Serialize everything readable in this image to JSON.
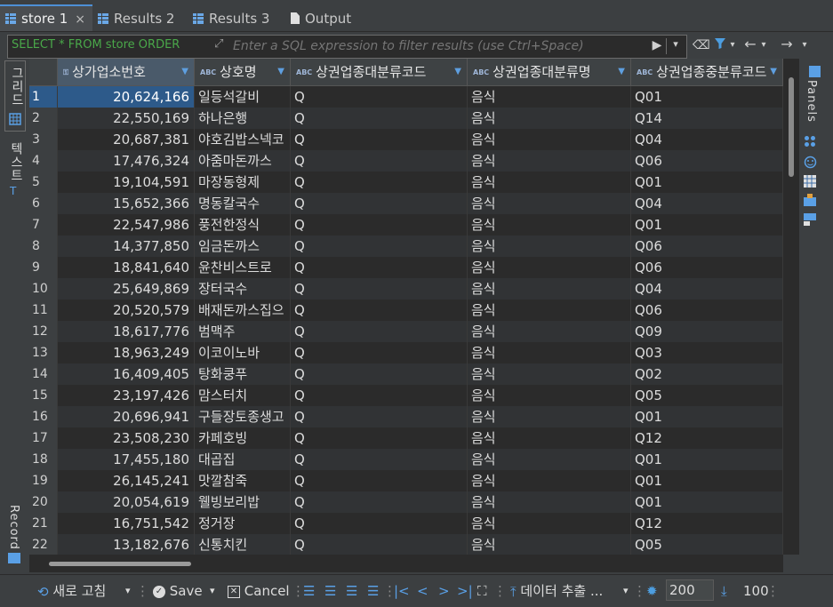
{
  "tabs": [
    {
      "label": "store 1",
      "close": "×",
      "active": true
    },
    {
      "label": "Results 2",
      "active": false
    },
    {
      "label": "Results 3",
      "active": false
    },
    {
      "label": "Output",
      "active": false
    }
  ],
  "filter": {
    "prefix": "SELECT * FROM store ORDER",
    "placeholder": "Enter a SQL expression to filter results (use Ctrl+Space)"
  },
  "left_panel": {
    "grid_label": "그리드",
    "text_label": "텍스트",
    "record_label": "Record"
  },
  "right_panel": {
    "panels_label": "Panels"
  },
  "columns": [
    {
      "label": "상가업소번호",
      "type": "key"
    },
    {
      "label": "상호명",
      "type": "text"
    },
    {
      "label": "상권업종대분류코드",
      "type": "text"
    },
    {
      "label": "상권업종대분류명",
      "type": "text"
    },
    {
      "label": "상권업종중분류코드",
      "type": "text"
    }
  ],
  "rows": [
    [
      "1",
      "20,624,166",
      "일등석갈비",
      "Q",
      "음식",
      "Q01"
    ],
    [
      "2",
      "22,550,169",
      "하나은행",
      "Q",
      "음식",
      "Q14"
    ],
    [
      "3",
      "20,687,381",
      "야호김밥스넥코",
      "Q",
      "음식",
      "Q04"
    ],
    [
      "4",
      "17,476,324",
      "아줌마돈까스",
      "Q",
      "음식",
      "Q06"
    ],
    [
      "5",
      "19,104,591",
      "마장동형제",
      "Q",
      "음식",
      "Q01"
    ],
    [
      "6",
      "15,652,366",
      "명동칼국수",
      "Q",
      "음식",
      "Q04"
    ],
    [
      "7",
      "22,547,986",
      "풍전한정식",
      "Q",
      "음식",
      "Q01"
    ],
    [
      "8",
      "14,377,850",
      "임금돈까스",
      "Q",
      "음식",
      "Q06"
    ],
    [
      "9",
      "18,841,640",
      "윤찬비스트로",
      "Q",
      "음식",
      "Q06"
    ],
    [
      "10",
      "25,649,869",
      "장터국수",
      "Q",
      "음식",
      "Q04"
    ],
    [
      "11",
      "20,520,579",
      "배재돈까스집으",
      "Q",
      "음식",
      "Q06"
    ],
    [
      "12",
      "18,617,776",
      "범맥주",
      "Q",
      "음식",
      "Q09"
    ],
    [
      "13",
      "18,963,249",
      "이코이노바",
      "Q",
      "음식",
      "Q03"
    ],
    [
      "14",
      "16,409,405",
      "탕화쿵푸",
      "Q",
      "음식",
      "Q02"
    ],
    [
      "15",
      "23,197,426",
      "맘스터치",
      "Q",
      "음식",
      "Q05"
    ],
    [
      "16",
      "20,696,941",
      "구들장토종생고",
      "Q",
      "음식",
      "Q01"
    ],
    [
      "17",
      "23,508,230",
      "카페호빙",
      "Q",
      "음식",
      "Q12"
    ],
    [
      "18",
      "17,455,180",
      "대곱집",
      "Q",
      "음식",
      "Q01"
    ],
    [
      "19",
      "26,145,241",
      "맛깔참죽",
      "Q",
      "음식",
      "Q01"
    ],
    [
      "20",
      "20,054,619",
      "웰빙보리밥",
      "Q",
      "음식",
      "Q01"
    ],
    [
      "21",
      "16,751,542",
      "정거장",
      "Q",
      "음식",
      "Q12"
    ],
    [
      "22",
      "13,182,676",
      "신통치킨",
      "Q",
      "음식",
      "Q05"
    ]
  ],
  "selected_row": 0,
  "bottom": {
    "refresh_label": "새로 고침",
    "save_label": "Save",
    "cancel_label": "Cancel",
    "export_label": "데이터 추출 ...",
    "fetch_size": "200",
    "row_count": "100"
  }
}
